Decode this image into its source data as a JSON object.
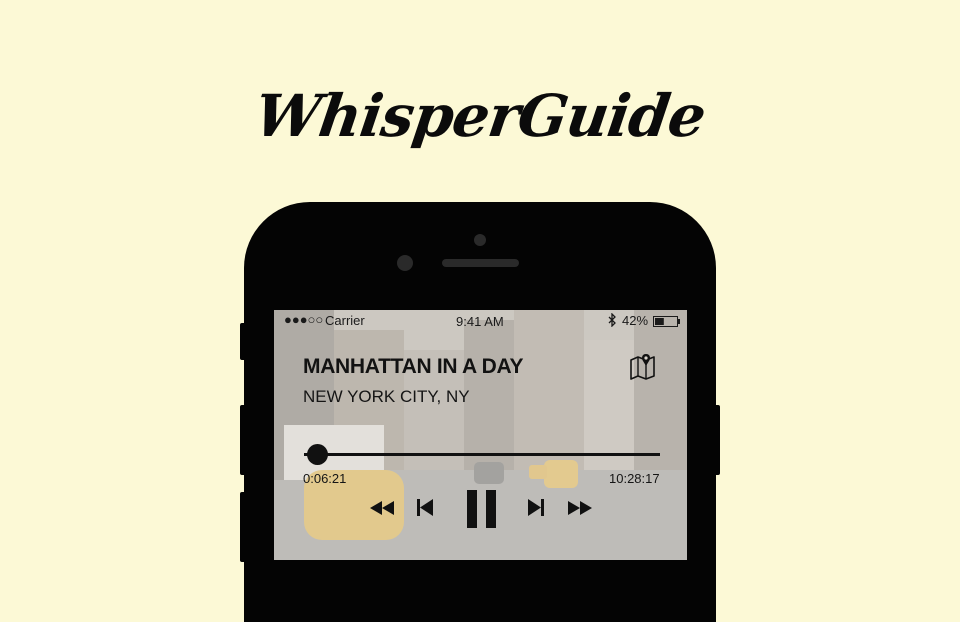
{
  "brand": {
    "title": "WhisperGuide"
  },
  "status_bar": {
    "signal_text": "●●●○○",
    "carrier": "Carrier",
    "time": "9:41 AM",
    "battery_percent": "42%",
    "battery_level": 0.42,
    "bluetooth_icon": "bluetooth-icon"
  },
  "player": {
    "title": "MANHATTAN IN A DAY",
    "subtitle": "NEW YORK CITY, NY",
    "elapsed": "0:06:21",
    "total": "10:28:17",
    "progress": 0.01,
    "icons": {
      "map": "map-pin-icon",
      "rewind": "rewind-icon",
      "previous": "skip-previous-icon",
      "pause": "pause-icon",
      "next": "skip-next-icon",
      "fast_forward": "fast-forward-icon"
    }
  },
  "colors": {
    "background": "#fcf9d6",
    "phone": "#040404",
    "text": "#121212"
  }
}
